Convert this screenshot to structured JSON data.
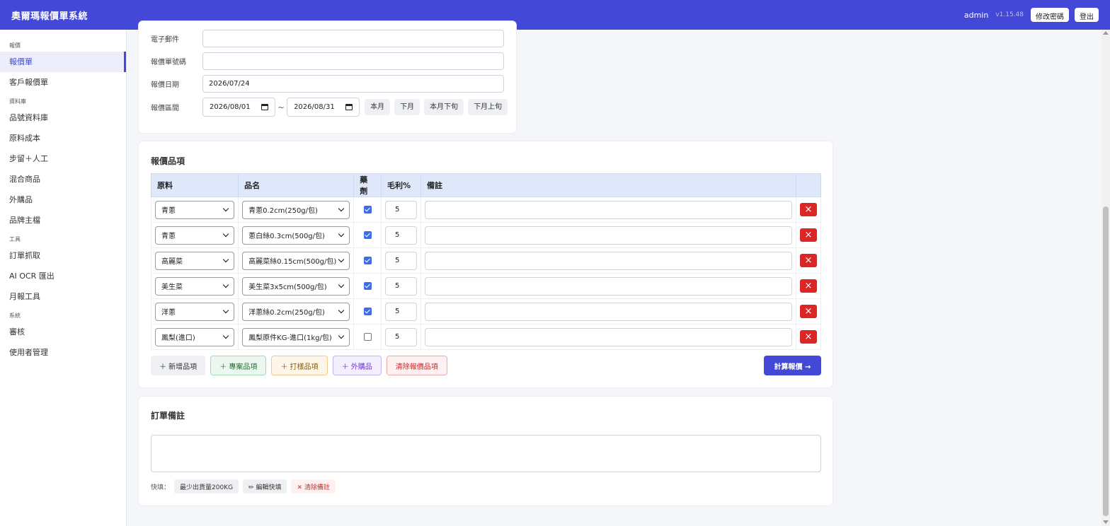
{
  "header": {
    "title": "奧爾瑪報價單系統",
    "user": "admin",
    "version": "v1.15.48",
    "change_password": "修改密碼",
    "logout": "登出"
  },
  "sidebar": {
    "groups": [
      {
        "label": "報價",
        "items": [
          {
            "label": "報價單",
            "active": true
          },
          {
            "label": "客戶報價單"
          }
        ]
      },
      {
        "label": "資料庫",
        "items": [
          {
            "label": "品號資料庫"
          },
          {
            "label": "原料成本"
          },
          {
            "label": "步留＋人工"
          },
          {
            "label": "混合商品"
          },
          {
            "label": "外購品"
          },
          {
            "label": "品牌主檔"
          }
        ]
      },
      {
        "label": "工具",
        "items": [
          {
            "label": "訂單抓取"
          },
          {
            "label": "AI OCR 匯出"
          },
          {
            "label": "月報工具"
          }
        ]
      },
      {
        "label": "系統",
        "items": [
          {
            "label": "審核"
          },
          {
            "label": "使用者管理"
          }
        ]
      }
    ]
  },
  "form": {
    "email_label": "電子郵件",
    "email_value": "",
    "quote_no_label": "報價單號碼",
    "quote_no_value": "",
    "quote_date_label": "報價日期",
    "quote_date_value": "2026/07/24",
    "period_label": "報價區間",
    "period_start": "2026/08/01",
    "period_end": "2026/08/31",
    "period_sep": "~",
    "quick_periods": [
      "本月",
      "下月",
      "本月下旬",
      "下月上旬"
    ]
  },
  "items_section": {
    "title": "報價品項",
    "columns": [
      "原料",
      "品名",
      "藥劑",
      "毛利%",
      "備註",
      ""
    ],
    "rows": [
      {
        "material": "青蔥",
        "product": "青蔥0.2cm(250g/包)",
        "chemical": true,
        "margin": "5",
        "note": ""
      },
      {
        "material": "青蔥",
        "product": "蔥白絲0.3cm(500g/包)",
        "chemical": true,
        "margin": "5",
        "note": ""
      },
      {
        "material": "高麗菜",
        "product": "高麗菜絲0.15cm(500g/包)",
        "chemical": true,
        "margin": "5",
        "note": ""
      },
      {
        "material": "美生菜",
        "product": "美生菜3x5cm(500g/包)",
        "chemical": true,
        "margin": "5",
        "note": ""
      },
      {
        "material": "洋蔥",
        "product": "洋蔥絲0.2cm(250g/包)",
        "chemical": true,
        "margin": "5",
        "note": ""
      },
      {
        "material": "鳳梨(進口)",
        "product": "鳳梨原件KG-進口(1kg/包)",
        "chemical": false,
        "margin": "5",
        "note": ""
      }
    ],
    "delete_glyph": "×",
    "buttons": {
      "add_item": "＋ 新增品項",
      "project_item": "＋ 專案品項",
      "sample_item": "＋ 打樣品項",
      "purchased_item": "＋ 外購品",
      "clear_items": "清除報價品項",
      "calculate": "計算報價 →"
    }
  },
  "order_note": {
    "title": "訂單備註",
    "value": "",
    "quick_label": "快填：",
    "quick_fill": "最少出貨量200KG",
    "edit_quick": "✏ 編輯快填",
    "clear_note": "✕ 清除備註"
  }
}
